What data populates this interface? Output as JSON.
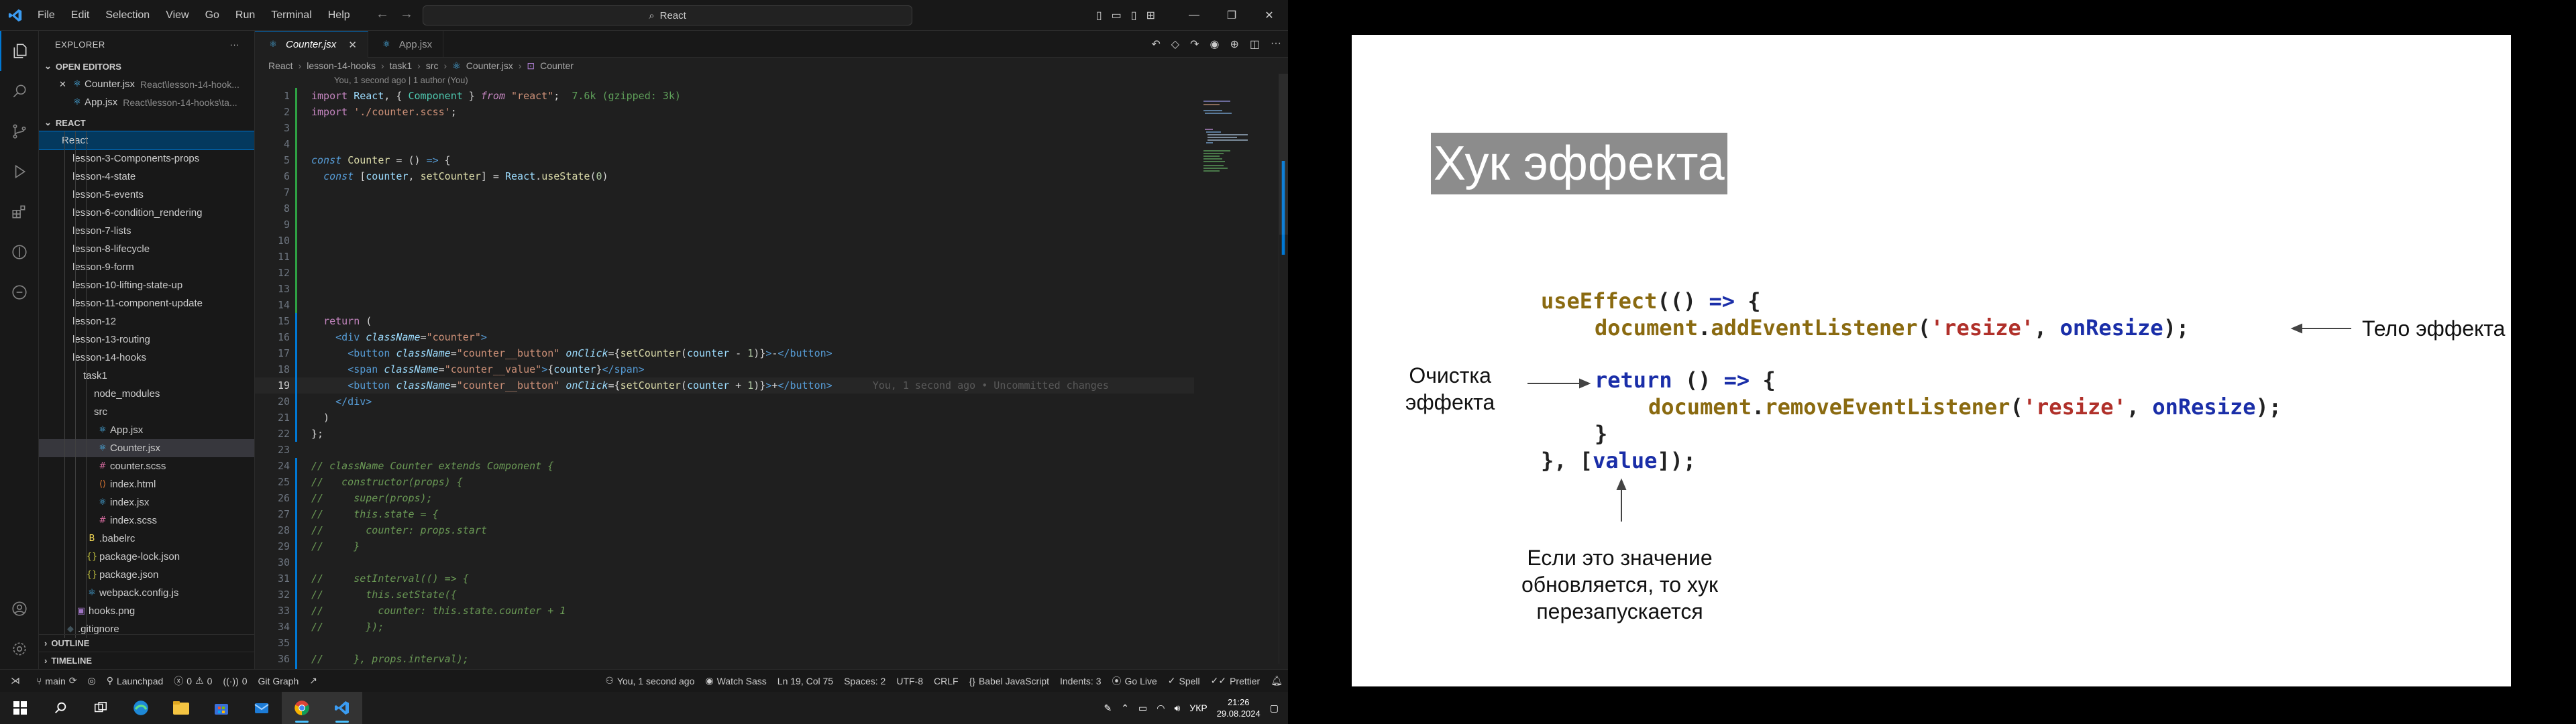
{
  "vscode": {
    "menu": [
      "File",
      "Edit",
      "Selection",
      "View",
      "Go",
      "Run",
      "Terminal",
      "Help"
    ],
    "search_text": "React",
    "explorer_title": "EXPLORER",
    "open_editors_title": "OPEN EDITORS",
    "open_editors": [
      {
        "name": "Counter.jsx",
        "path": "React\\lesson-14-hook..."
      },
      {
        "name": "App.jsx",
        "path": "React\\lesson-14-hooks\\ta..."
      }
    ],
    "workspace_title": "REACT",
    "tree": [
      {
        "name": "React",
        "type": "folder",
        "indent": 0
      },
      {
        "name": "lesson-3-Components-props",
        "type": "folder",
        "indent": 1
      },
      {
        "name": "lesson-4-state",
        "type": "folder",
        "indent": 1
      },
      {
        "name": "lesson-5-events",
        "type": "folder",
        "indent": 1
      },
      {
        "name": "lesson-6-condition_rendering",
        "type": "folder",
        "indent": 1
      },
      {
        "name": "lesson-7-lists",
        "type": "folder",
        "indent": 1
      },
      {
        "name": "lesson-8-lifecycle",
        "type": "folder",
        "indent": 1
      },
      {
        "name": "lesson-9-form",
        "type": "folder",
        "indent": 1
      },
      {
        "name": "lesson-10-lifting-state-up",
        "type": "folder",
        "indent": 1
      },
      {
        "name": "lesson-11-component-update",
        "type": "folder",
        "indent": 1
      },
      {
        "name": "lesson-12",
        "type": "folder",
        "indent": 1
      },
      {
        "name": "lesson-13-routing",
        "type": "folder",
        "indent": 1
      },
      {
        "name": "lesson-14-hooks",
        "type": "folder",
        "indent": 1
      },
      {
        "name": "task1",
        "type": "folder",
        "indent": 2
      },
      {
        "name": "node_modules",
        "type": "folder",
        "indent": 3
      },
      {
        "name": "src",
        "type": "folder",
        "indent": 3
      },
      {
        "name": "App.jsx",
        "type": "react",
        "indent": 4
      },
      {
        "name": "Counter.jsx",
        "type": "react",
        "indent": 4,
        "selected": true
      },
      {
        "name": "counter.scss",
        "type": "scss",
        "indent": 4
      },
      {
        "name": "index.html",
        "type": "html",
        "indent": 4
      },
      {
        "name": "index.jsx",
        "type": "react",
        "indent": 4
      },
      {
        "name": "index.scss",
        "type": "scss",
        "indent": 4
      },
      {
        "name": ".babelrc",
        "type": "babel",
        "indent": 3
      },
      {
        "name": "package-lock.json",
        "type": "json",
        "indent": 3
      },
      {
        "name": "package.json",
        "type": "json",
        "indent": 3
      },
      {
        "name": "webpack.config.js",
        "type": "react",
        "indent": 3
      },
      {
        "name": "hooks.png",
        "type": "img",
        "indent": 2
      },
      {
        "name": ".gitignore",
        "type": "git",
        "indent": 1
      }
    ],
    "outline_title": "OUTLINE",
    "timeline_title": "TIMELINE",
    "tabs": [
      {
        "name": "Counter.jsx",
        "active": true
      },
      {
        "name": "App.jsx",
        "active": false
      }
    ],
    "breadcrumb": [
      "React",
      "lesson-14-hooks",
      "task1",
      "src",
      "Counter.jsx",
      "Counter"
    ],
    "codelens": "You, 1 second ago | 1 author (You)",
    "blame": "You, 1 second ago • Uncommitted changes",
    "status": {
      "branch": "main",
      "launchpad": "Launchpad",
      "errors": "0",
      "warnings": "0",
      "ports": "0",
      "git_graph": "Git Graph",
      "blame": "You, 1 second ago",
      "watch_sass": "Watch Sass",
      "position": "Ln 19, Col 75",
      "spaces": "Spaces: 2",
      "encoding": "UTF-8",
      "eol": "CRLF",
      "language": "Babel JavaScript",
      "indents": "Indents: 3",
      "go_live": "Go Live",
      "spell": "Spell",
      "prettier": "Prettier"
    }
  },
  "taskbar": {
    "lang": "УКР",
    "time": "21:26",
    "date": "29.08.2024"
  },
  "slide": {
    "title": "Хук эффекта",
    "code_lines": [
      "useEffect(() => {",
      "document.addEventListener('resize', onResize);",
      "return () => {",
      "document.removeEventListener('resize', onResize);",
      "}",
      "}, [value]);"
    ],
    "label_body": "Тело эффекта",
    "label_cleanup_1": "Очистка",
    "label_cleanup_2": "эффекта",
    "label_deps_1": "Если это значение",
    "label_deps_2": "обновляется, то хук",
    "label_deps_3": "перезапускается"
  }
}
